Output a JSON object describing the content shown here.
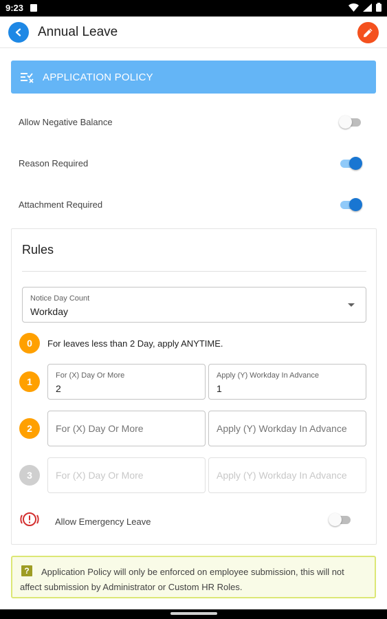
{
  "status_bar": {
    "time": "9:23"
  },
  "app_bar": {
    "title": "Annual Leave"
  },
  "application_policy": {
    "header": "APPLICATION POLICY",
    "toggles": [
      {
        "label": "Allow Negative Balance",
        "on": false
      },
      {
        "label": "Reason Required",
        "on": true
      },
      {
        "label": "Attachment Required",
        "on": true
      }
    ]
  },
  "rules": {
    "title": "Rules",
    "notice_day_count": {
      "label": "Notice Day Count",
      "value": "Workday"
    },
    "rule0": {
      "number": "0",
      "text": "For leaves less than 2 Day, apply ANYTIME."
    },
    "rows": [
      {
        "number": "1",
        "x_label": "For (X) Day Or More",
        "x_value": "2",
        "y_label": "Apply (Y) Workday In Advance",
        "y_value": "1"
      },
      {
        "number": "2",
        "x_placeholder": "For (X) Day Or More",
        "y_placeholder": "Apply (Y) Workday In Advance"
      },
      {
        "number": "3",
        "x_placeholder": "For (X) Day Or More",
        "y_placeholder": "Apply (Y) Workday In Advance"
      }
    ],
    "emergency": {
      "label": "Allow Emergency Leave",
      "on": false
    }
  },
  "note": {
    "icon": "?",
    "text": "Application Policy will only be enforced on employee submission, this will not affect submission by Administrator or Custom HR Roles."
  },
  "colors": {
    "primary_blue": "#1e88e5",
    "header_blue": "#64b5f6",
    "edit_orange": "#f4511e",
    "badge_orange": "#ffa000",
    "note_background": "#f9fbe7",
    "note_border": "#dce775",
    "emergency_red": "#d32f2f"
  }
}
